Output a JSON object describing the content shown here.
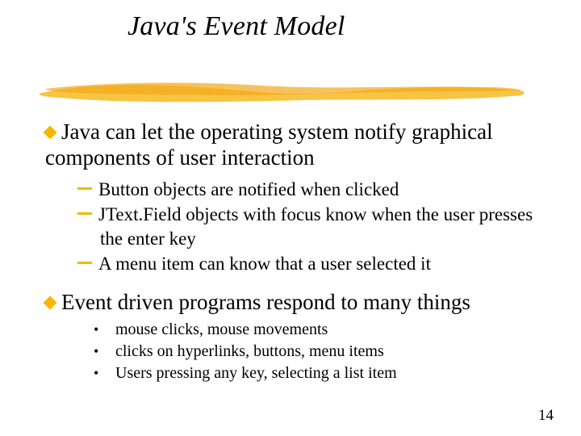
{
  "title": "Java's Event Model",
  "bullets": {
    "main1": "Java can let the operating system notify graphical components of user interaction",
    "sub1": [
      "Button objects are notified when clicked",
      "JText.Field objects with focus know when the user presses the enter key",
      "A menu item can know that a user selected it"
    ],
    "main2": "Event driven programs respond to many things",
    "sub2": [
      "mouse clicks, mouse movements",
      "clicks on hyperlinks, buttons, menu items",
      "Users pressing any key, selecting a list item"
    ]
  },
  "page_number": "14",
  "colors": {
    "accent": "#f7b500"
  }
}
